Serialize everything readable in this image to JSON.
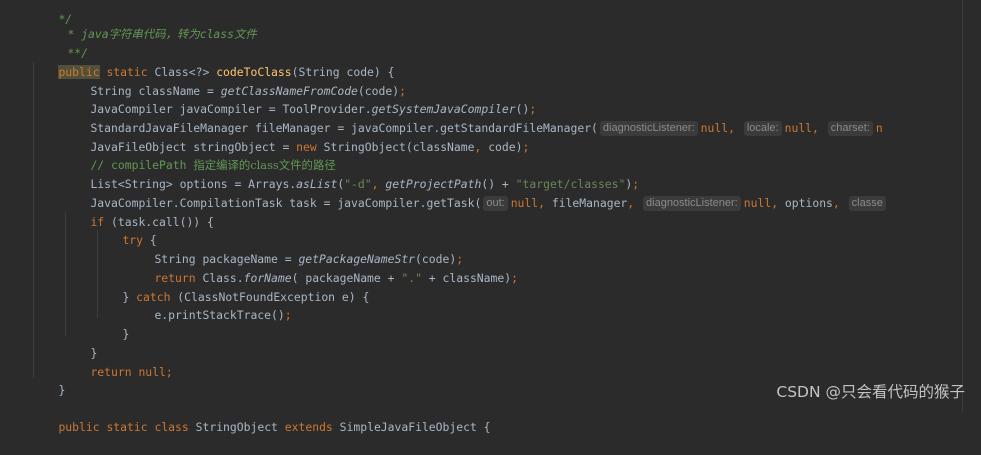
{
  "lines": {
    "l00": [
      "*/"
    ],
    "l01": [
      "* java字符串代码，转为class文件"
    ],
    "l02": [
      "**/"
    ],
    "l03": [
      "public",
      " ",
      "static",
      " Class<?> ",
      "codeToClass",
      "(String code) {"
    ],
    "l04": [
      "String className = ",
      "getClassNameFromCode",
      "(code)",
      ";"
    ],
    "l05": [
      "JavaCompiler javaCompiler = ToolProvider.",
      "getSystemJavaCompiler",
      "()",
      ";"
    ],
    "l06": [
      "StandardJavaFileManager fileManager = javaCompiler.getStandardFileManager(",
      "diagnosticListener:",
      "null",
      ", ",
      "locale:",
      "null",
      ", ",
      "charset:",
      "n"
    ],
    "l07": [
      "JavaFileObject stringObject = ",
      "new",
      " StringObject(className",
      ",",
      " code)",
      ";"
    ],
    "l08": [
      "// compilePath ",
      "指定编译的class文件的路径"
    ],
    "l09": [
      "List<String> options = Arrays.",
      "asList",
      "(",
      "\"-d\"",
      ", ",
      "getProjectPath",
      "() + ",
      "\"target/classes\"",
      ")",
      ";"
    ],
    "l10": [
      "JavaCompiler.CompilationTask task = javaCompiler.getTask(",
      "out:",
      "null",
      ", ",
      "fileManager",
      ", ",
      "diagnosticListener:",
      "null",
      ", ",
      "options",
      ", ",
      "classe"
    ],
    "l11": [
      "if",
      " (task.call()) {"
    ],
    "l12": [
      "try",
      " {"
    ],
    "l13": [
      "String packageName = ",
      "getPackageNameStr",
      "(code)",
      ";"
    ],
    "l14": [
      "return",
      " Class.",
      "forName",
      "( packageName + ",
      "\".\"",
      " + className)",
      ";"
    ],
    "l15": [
      "} ",
      "catch",
      " (ClassNotFoundException e) {"
    ],
    "l16": [
      "e.printStackTrace()",
      ";"
    ],
    "l17": [
      "}"
    ],
    "l18": [
      "}"
    ],
    "l19": [
      "return",
      " ",
      "null",
      ";"
    ],
    "l20": [
      "}"
    ],
    "l21": [
      "public",
      " ",
      "static",
      " ",
      "class",
      " StringObject ",
      "extends",
      " SimpleJavaFileObject {"
    ]
  },
  "watermark": "CSDN @只会看代码的猴子",
  "colors": {
    "background": "#2b2b2b",
    "keyword": "#cc7832",
    "method_decl": "#ffc66d",
    "string": "#6a8759",
    "doc_comment": "#629755",
    "line_comment": "#808080",
    "default_text": "#a9b7c6",
    "inlay_hint_bg": "#3b3b3b",
    "inlay_hint_fg": "#8b8b8b"
  }
}
